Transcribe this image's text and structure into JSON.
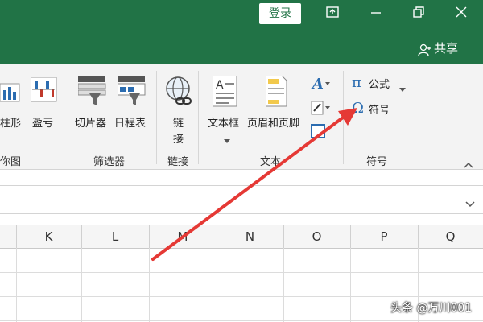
{
  "titlebar": {
    "login_label": "登录",
    "share_label": "共享",
    "accent": "#217346"
  },
  "ribbon": {
    "items": {
      "sparkline_partial": "柱形",
      "win_loss": "盈亏",
      "slicer": "切片器",
      "timeline": "日程表",
      "link_line1": "链",
      "link_line2": "接",
      "textbox": "文本框",
      "header_footer": "页眉和页脚",
      "formula": "公式",
      "symbol": "符号"
    },
    "groups": {
      "charts_partial": "你图",
      "filters": "筛选器",
      "links": "链接",
      "text": "文本",
      "symbols": "符号"
    },
    "icons": [
      "bar-chart-icon",
      "winloss-icon",
      "slicer-icon",
      "timeline-icon",
      "globe-link-icon",
      "textbox-icon",
      "header-footer-icon",
      "wordart-icon",
      "signature-icon",
      "object-icon",
      "pi-icon",
      "omega-icon"
    ]
  },
  "columns": [
    "K",
    "L",
    "M",
    "N",
    "O",
    "P",
    "Q"
  ],
  "watermark": "头条 @万川001",
  "annotation": {
    "arrow_color": "#e53935"
  }
}
